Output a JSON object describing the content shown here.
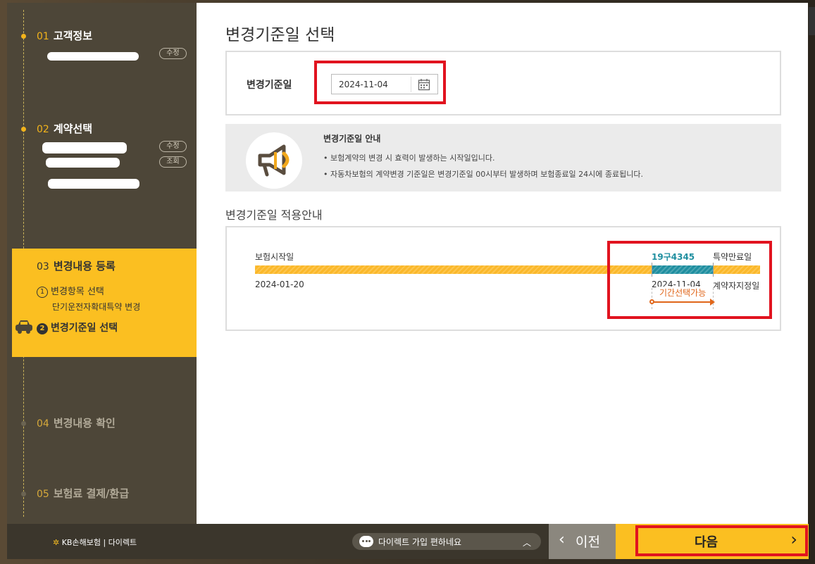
{
  "sidebar": {
    "steps": [
      {
        "num": "01",
        "title": "고객정보",
        "pill1": "수정"
      },
      {
        "num": "02",
        "title": "계약선택",
        "pill1": "수정",
        "pill2": "조회"
      },
      {
        "num": "03",
        "title": "변경내용 등록",
        "sub1": {
          "idx": "1",
          "label": "변경항목 선택",
          "detail": "단기운전자확대특약 변경"
        },
        "sub2": {
          "idx": "2",
          "label": "변경기준일 선택"
        }
      },
      {
        "num": "04",
        "title": "변경내용 확인"
      },
      {
        "num": "05",
        "title": "보험료 결제/환급"
      }
    ]
  },
  "main": {
    "title": "변경기준일 선택",
    "date_label": "변경기준일",
    "date_value": "2024-11-04",
    "notice": {
      "title": "변경기준일 안내",
      "line1": "• 보험계약의 변경 시 효력이 발생하는 시작일입니다.",
      "line2": "• 자동차보험의 계약변경 기준일은 변경기준일 00시부터 발생하며 보험종료일 24시에 종료됩니다."
    },
    "apply_title": "변경기준일 적용안내",
    "timeline": {
      "start_label": "보험시작일",
      "start_date": "2024-01-20",
      "car_number": "19구4345",
      "end_label": "특약만료일",
      "change_date": "2024-11-04",
      "designated_label": "계약자지정일",
      "period_possible": "기간선택가능"
    }
  },
  "footer": {
    "brand_mark": "✲",
    "brand_name": "KB손해보험",
    "brand_sep": "|",
    "brand_sub": "다이렉트",
    "chat_text": "다이렉트 가입 편하네요",
    "prev_label": "이전",
    "next_label": "다음"
  },
  "colors": {
    "accent": "#fbbf21",
    "teal": "#1f8fa0",
    "highlight": "#e1131f",
    "sidebar": "#4d4638"
  }
}
